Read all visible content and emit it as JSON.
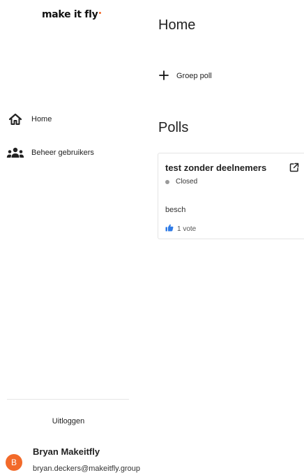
{
  "brand": {
    "logo_text": "make it fly",
    "accent": "#f26a2a"
  },
  "sidebar": {
    "items": [
      {
        "label": "Home",
        "icon": "home-icon"
      },
      {
        "label": "Beheer gebruikers",
        "icon": "users-icon"
      }
    ],
    "logout_label": "Uitloggen"
  },
  "user": {
    "initial": "B",
    "name": "Bryan Makeitfly",
    "email": "bryan.deckers@makeitfly.group"
  },
  "main": {
    "title": "Home",
    "add_group_poll_label": "Groep poll",
    "polls_title": "Polls",
    "polls": [
      {
        "title": "test zonder deelnemers",
        "status": "Closed",
        "status_color": "#9a9a9a",
        "description": "besch",
        "votes_label": "1 vote",
        "vote_icon_color": "#2f7be6"
      }
    ]
  }
}
